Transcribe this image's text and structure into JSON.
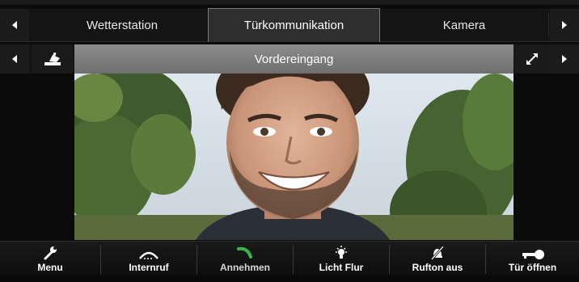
{
  "tabs": {
    "items": [
      {
        "label": "Wetterstation"
      },
      {
        "label": "Türkommunikation",
        "active": true
      },
      {
        "label": "Kamera"
      }
    ],
    "prev_icon": "triangle-left-icon",
    "next_icon": "triangle-right-icon"
  },
  "camera": {
    "title": "Vordereingang",
    "camera_icon": "security-camera-icon",
    "fullscreen_icon": "expand-arrows-icon"
  },
  "actions": [
    {
      "label": "Menu",
      "icon": "wrench-icon"
    },
    {
      "label": "Internruf",
      "icon": "intercom-handset-icon"
    },
    {
      "label": "Annehmen",
      "icon": "accept-call-icon"
    },
    {
      "label": "Licht Flur",
      "icon": "light-bulb-icon"
    },
    {
      "label": "Rufton aus",
      "icon": "bell-muted-icon"
    },
    {
      "label": "Tür öffnen",
      "icon": "key-icon"
    }
  ],
  "colors": {
    "accept_green": "#39b54a",
    "title_bar": "#7d7d7d",
    "active_tab": "#2e2e2e"
  }
}
